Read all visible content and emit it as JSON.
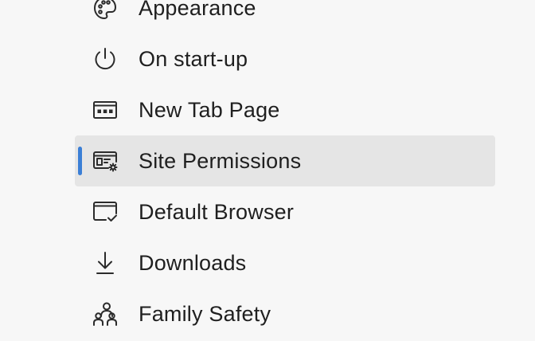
{
  "sidebar": {
    "accent_color": "#3b7fd6",
    "selected_background": "#e5e5e5",
    "items": [
      {
        "label": "Appearance",
        "icon": "palette-icon"
      },
      {
        "label": "On start-up",
        "icon": "power-icon"
      },
      {
        "label": "New Tab Page",
        "icon": "new-tab-page-icon"
      },
      {
        "label": "Site Permissions",
        "icon": "site-permissions-icon",
        "selected": true
      },
      {
        "label": "Default Browser",
        "icon": "default-browser-icon"
      },
      {
        "label": "Downloads",
        "icon": "download-icon"
      },
      {
        "label": "Family Safety",
        "icon": "family-icon"
      }
    ]
  }
}
